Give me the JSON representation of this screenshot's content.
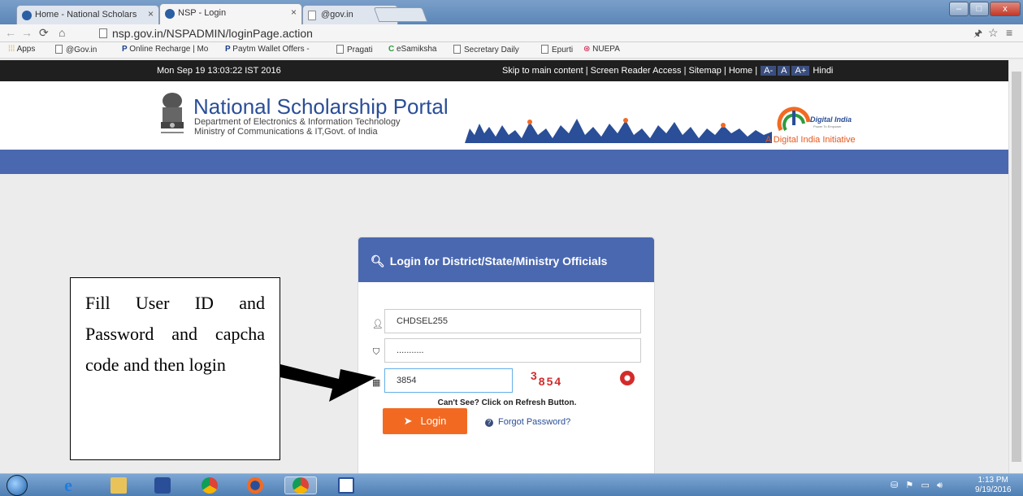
{
  "browser": {
    "tabs": [
      {
        "label": "Home - National Scholars"
      },
      {
        "label": "NSP - Login"
      },
      {
        "label": "@gov.in"
      }
    ],
    "url": "nsp.gov.in/NSPADMIN/loginPage.action",
    "bookmarks": [
      "Apps",
      "@Gov.in",
      "Online Recharge | Mo",
      "Paytm Wallet Offers -",
      "Pragati",
      "eSamiksha",
      "Secretary Daily",
      "Epurti",
      "NUEPA"
    ]
  },
  "page": {
    "datetime": "Mon Sep 19 13:03:22 IST 2016",
    "top_links": {
      "prefix": "Skip to main content | Screen Reader Access | Sitemap | Home |",
      "font_small": "A-",
      "font_normal": "A",
      "font_large": "A+",
      "language": "Hindi"
    },
    "header": {
      "title": "National Scholarship Portal",
      "dept": "Department of Electronics & Information Technology",
      "ministry": "Ministry of Communications & IT,Govt. of India",
      "digital_india_logo": "Digital India",
      "digital_india_tag": "Power To Empower",
      "digital_india_text": "A Digital India Initiative"
    },
    "login": {
      "heading": "Login for District/State/Ministry Officials",
      "user_id": "CHDSEL255",
      "password_mask": "...........",
      "captcha_input": "3854",
      "captcha_image_first": "3",
      "captcha_image_rest": "854",
      "refresh_hint": "Can't See? Click on Refresh Button.",
      "login_label": "Login",
      "forgot_label": "Forgot Password?"
    },
    "annotation": "Fill User ID and Password and capcha code and then login"
  },
  "taskbar": {
    "time": "1:13 PM",
    "date": "9/19/2016"
  },
  "colors": {
    "brand_blue": "#4a68b0",
    "login_orange": "#f26a22",
    "captcha_red": "#d32b2b"
  }
}
